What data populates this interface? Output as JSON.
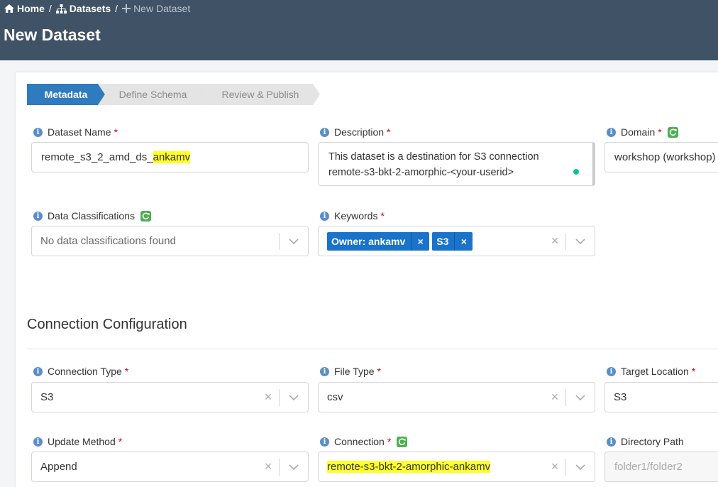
{
  "breadcrumb": {
    "home": "Home",
    "datasets": "Datasets",
    "current": "New Dataset",
    "separator": "/"
  },
  "page": {
    "title": "New Dataset"
  },
  "wizard": {
    "steps": [
      {
        "label": "Metadata",
        "active": true
      },
      {
        "label": "Define Schema",
        "active": false
      },
      {
        "label": "Review & Publish",
        "active": false
      }
    ]
  },
  "fields": {
    "dataset_name": {
      "label": "Dataset Name",
      "value_prefix": "remote_s3_2_amd_ds_",
      "value_highlight": "ankamv",
      "required": "*"
    },
    "description": {
      "label": "Description",
      "required": "*",
      "line1": "This dataset is a destination for S3 connection",
      "line2": "remote-s3-bkt-2-amorphic-<your-userid>"
    },
    "domain": {
      "label": "Domain",
      "required": "*",
      "value": "workshop (workshop)"
    },
    "data_classifications": {
      "label": "Data Classifications",
      "placeholder": "No data classifications found"
    },
    "keywords": {
      "label": "Keywords",
      "required": "*",
      "tags": [
        "Owner: ankamv",
        "S3"
      ],
      "tag_remove": "×"
    }
  },
  "connection": {
    "section_title": "Connection Configuration",
    "connection_type": {
      "label": "Connection Type",
      "required": "*",
      "value": "S3"
    },
    "file_type": {
      "label": "File Type",
      "required": "*",
      "value": "csv"
    },
    "target_location": {
      "label": "Target Location",
      "required": "*",
      "value": "S3"
    },
    "update_method": {
      "label": "Update Method",
      "required": "*",
      "value": "Append"
    },
    "connection": {
      "label": "Connection",
      "required": "*",
      "value": "remote-s3-bkt-2-amorphic-ankamv"
    },
    "directory_path": {
      "label": "Directory Path",
      "placeholder": "folder1/folder2"
    }
  },
  "icons": {
    "info": "i",
    "clear": "×"
  },
  "colors": {
    "header_bg": "#3f5266",
    "step_active": "#2f7bc0",
    "step_inactive": "#e4e4e4",
    "tag_bg": "#1a73c9",
    "refresh": "#4caf50",
    "highlight": "#ffff2b",
    "required": "#d0021b"
  }
}
